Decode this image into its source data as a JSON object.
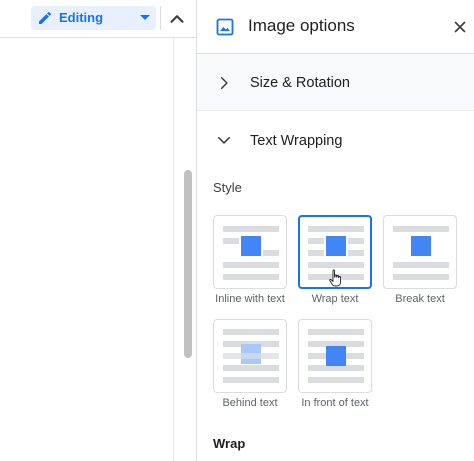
{
  "toolbar": {
    "mode_label": "Editing",
    "mode_icon": "pencil-icon",
    "collapse_icon": "chevron-up-icon"
  },
  "panel": {
    "title": "Image options",
    "title_icon": "image-icon",
    "close_icon": "close-icon",
    "sections": {
      "size_rotation": {
        "label": "Size & Rotation",
        "expanded": false
      },
      "text_wrapping": {
        "label": "Text Wrapping",
        "expanded": true
      }
    },
    "style_label": "Style",
    "wrap_label": "Wrap",
    "options": [
      {
        "label": "Inline with text",
        "selected": false
      },
      {
        "label": "Wrap text",
        "selected": true
      },
      {
        "label": "Break text",
        "selected": false
      },
      {
        "label": "Behind text",
        "selected": false
      },
      {
        "label": "In front of text",
        "selected": false
      }
    ]
  },
  "colors": {
    "accent": "#1a73e8",
    "image_blue": "#4285f4",
    "line_gray": "#dadce0"
  }
}
